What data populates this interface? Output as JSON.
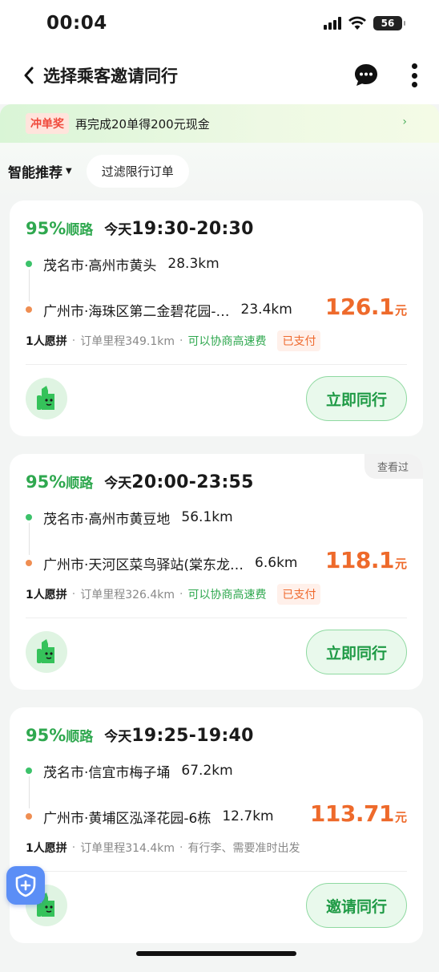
{
  "status_bar": {
    "time": "00:04",
    "battery": "56"
  },
  "nav": {
    "title": "选择乘客邀请同行"
  },
  "banner": {
    "tag": "冲单奖",
    "text": "再完成20单得200元现金",
    "arrow": "›"
  },
  "filters": {
    "sort_label": "智能推荐",
    "chip": "过滤限行订单"
  },
  "cards": [
    {
      "match_pct": "95%",
      "match_word": "顺路",
      "day": "今天",
      "time_range": "19:30-20:30",
      "from_place": "茂名市·高州市黄头",
      "from_dist": "28.3km",
      "to_place": "广州市·海珠区第二金碧花园-…",
      "to_dist": "23.4km",
      "price": "126.1",
      "price_unit": "元",
      "seat": "1人愿拼",
      "mileage": "订单里程349.1km",
      "note": "可以协商高速费",
      "paid": "已支付",
      "action": "立即同行"
    },
    {
      "seen": "查看过",
      "match_pct": "95%",
      "match_word": "顺路",
      "day": "今天",
      "time_range": "20:00-23:55",
      "from_place": "茂名市·高州市黄豆地",
      "from_dist": "56.1km",
      "to_place": "广州市·天河区菜鸟驿站(棠东龙…",
      "to_dist": "6.6km",
      "price": "118.1",
      "price_unit": "元",
      "seat": "1人愿拼",
      "mileage": "订单里程326.4km",
      "note": "可以协商高速费",
      "paid": "已支付",
      "action": "立即同行"
    },
    {
      "match_pct": "95%",
      "match_word": "顺路",
      "day": "今天",
      "time_range": "19:25-19:40",
      "from_place": "茂名市·信宜市梅子埇",
      "from_dist": "67.2km",
      "to_place": "广州市·黄埔区泓泽花园-6栋",
      "to_dist": "12.7km",
      "price": "113.71",
      "price_unit": "元",
      "seat": "1人愿拼",
      "mileage": "订单里程314.4km",
      "note": "有行李、需要准时出发",
      "action": "邀请同行"
    }
  ],
  "colors": {
    "accent_green": "#2fa84f",
    "price_orange": "#ee6a2b",
    "float_blue": "#5b8ef6"
  }
}
